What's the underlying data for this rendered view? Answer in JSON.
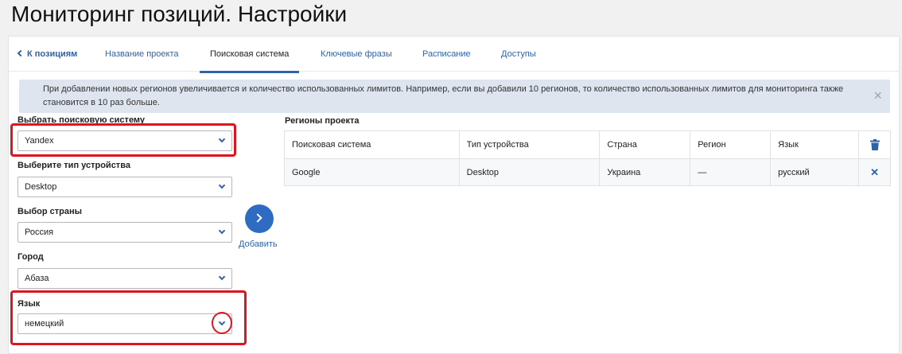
{
  "page": {
    "title": "Мониторинг позиций. Настройки"
  },
  "tabs": [
    {
      "label": "К позициям"
    },
    {
      "label": "Название проекта"
    },
    {
      "label": "Поисковая система"
    },
    {
      "label": "Ключевые фразы"
    },
    {
      "label": "Расписание"
    },
    {
      "label": "Доступы"
    }
  ],
  "active_tab": "Поисковая система",
  "notice": {
    "text": "При добавлении новых регионов увеличивается и количество использованных лимитов. Например, если вы добавили 10 регионов, то количество использованных лимитов для мониторинга также становится в 10 раз больше.",
    "close": "×"
  },
  "form": {
    "search_engine": {
      "label": "Выбрать поисковую систему",
      "value": "Yandex"
    },
    "device_type": {
      "label": "Выберите тип устройства",
      "value": "Desktop"
    },
    "country": {
      "label": "Выбор страны",
      "value": "Россия"
    },
    "city": {
      "label": "Город",
      "value": "Абаза"
    },
    "language": {
      "label": "Язык",
      "value": "немецкий"
    }
  },
  "add_button": {
    "label": "Добавить",
    "icon": "chevron-right-icon"
  },
  "regions": {
    "title": "Регионы проекта",
    "columns": [
      "Поисковая система",
      "Тип устройства",
      "Страна",
      "Регион",
      "Язык"
    ],
    "rows": [
      {
        "engine": "Google",
        "device": "Desktop",
        "country": "Украина",
        "region": "—",
        "language": "русский"
      }
    ]
  },
  "colors": {
    "accent": "#2e63a8",
    "button": "#2e6cc4",
    "notice_bg": "#dfe5ef",
    "highlight": "#e0141e"
  }
}
